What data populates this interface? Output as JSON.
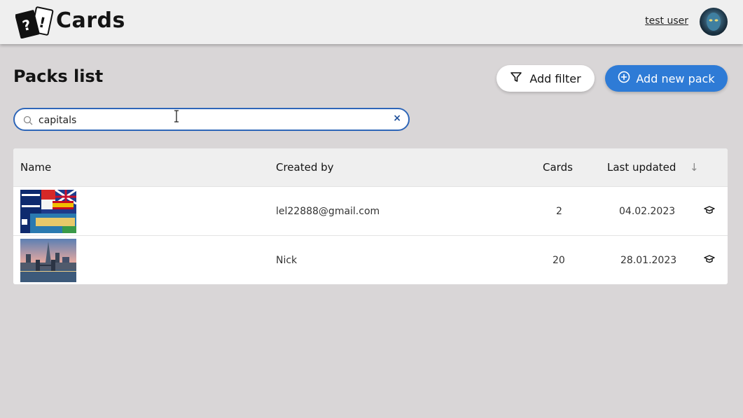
{
  "header": {
    "app_title": "Cards",
    "user_name": "test user"
  },
  "page": {
    "title": "Packs list",
    "add_filter_label": "Add filter",
    "add_pack_label": "Add new pack"
  },
  "search": {
    "value": "capitals",
    "clear_icon": "×"
  },
  "table": {
    "columns": [
      "Name",
      "Created by",
      "Cards",
      "Last updated"
    ],
    "sort_indicator": "↓",
    "rows": [
      {
        "created_by": "lel22888@gmail.com",
        "cards": "2",
        "last_updated": "04.02.2023"
      },
      {
        "created_by": "Nick",
        "cards": "20",
        "last_updated": "28.01.2023"
      }
    ]
  },
  "colors": {
    "accent": "#2e7bd6",
    "background": "#d9d6d7",
    "header": "#efefef"
  },
  "icons": [
    "logo-cards-icon",
    "avatar",
    "filter-icon",
    "plus-circle-icon",
    "search-icon",
    "clear-icon",
    "sort-arrow-icon",
    "learn-icon"
  ]
}
